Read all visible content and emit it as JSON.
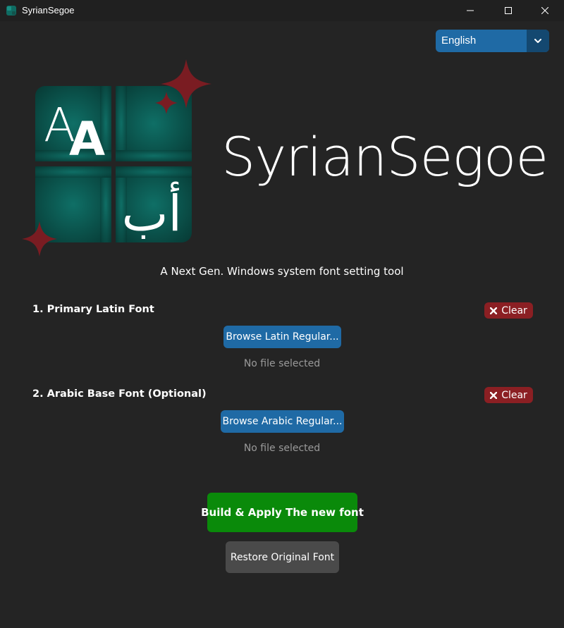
{
  "window": {
    "title": "SyrianSegoe",
    "app_icon": "app-icon",
    "controls": {
      "minimize": "minimize-icon",
      "maximize": "maximize-icon",
      "close": "close-icon"
    }
  },
  "language_selector": {
    "value": "English",
    "arrow_icon": "chevron-down-icon"
  },
  "logo": {
    "latin_glyphs": "AA",
    "arabic_glyphs": "أب",
    "sparkle_icon": "sparkle-icon"
  },
  "header": {
    "app_name": "SyrianSegoe",
    "tagline": "A Next Gen. Windows system font setting tool"
  },
  "sections": {
    "latin": {
      "label": "1. Primary Latin Font",
      "clear_label": "Clear",
      "browse_label": "Browse Latin Regular...",
      "status": "No file selected"
    },
    "arabic": {
      "label": "2. Arabic Base Font (Optional)",
      "clear_label": "Clear",
      "browse_label": "Browse Arabic Regular...",
      "status": "No file selected"
    }
  },
  "actions": {
    "build_label": "Build & Apply The new font",
    "restore_label": "Restore Original Font"
  },
  "colors": {
    "background": "#242424",
    "accent_blue": "#1f6aa5",
    "clear_red": "#8b1f23",
    "build_green": "#0a8a0a",
    "restore_gray": "#4a4a4a",
    "logo_teal": "#0d5a52",
    "sparkle_red": "#7a1c22"
  }
}
